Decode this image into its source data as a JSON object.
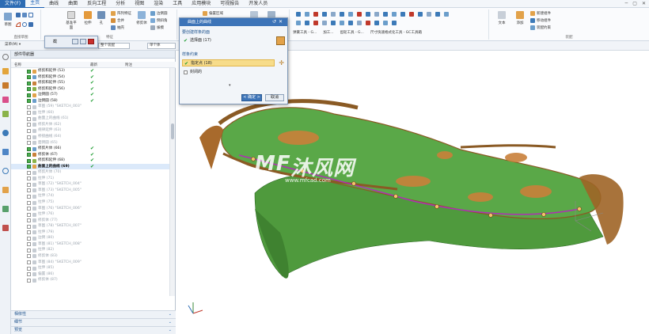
{
  "menubar": {
    "file_label": "文件(F)",
    "items": [
      "主页",
      "曲线",
      "曲面",
      "反向工程",
      "分析",
      "视图",
      "渲染",
      "工具",
      "应用模块",
      "可视报告",
      "开发人员"
    ],
    "window_controls": [
      "─",
      "▢",
      "✕"
    ]
  },
  "ribbon": {
    "groups": [
      {
        "label": "直接草图"
      },
      {
        "label": "特征"
      },
      {
        "label": "同步建模"
      },
      {
        "label": "尺寸快速格式化工具 - GC工具箱"
      },
      {
        "label": "装配"
      }
    ],
    "buttons": {
      "sketch": "草图",
      "datum_plane": "基准平面",
      "extrude": "拉伸",
      "hole": "孔",
      "pattern_feature": "阵列特征",
      "unite": "合并",
      "shell": "抽壳",
      "trim_body": "修剪体",
      "offset_region": "偏置区域",
      "replace_face": "替换面",
      "move_face": "移动面",
      "draft": "拔模",
      "more": "更多",
      "add_component": "添加",
      "new_component": "新建组件",
      "move_component": "移动组件",
      "assembly_constraint": "装配约束",
      "edge_blend": "边倒圆",
      "chamfer": "倒斜角",
      "text": "文本"
    },
    "toolbar_labels": [
      "弹簧工具 - G...",
      "加工...",
      "齿轮工具 - G...",
      "尺寸快速格式化工具 - GC工具箱"
    ]
  },
  "toolbar2": {
    "menu_label": "菜单(M) ▾",
    "filter_value": "没有选择过滤器",
    "assembly_value": "整个装配",
    "selection_value": "单个体"
  },
  "miniwin": {
    "title": "截"
  },
  "navigator": {
    "title": "部件导航器",
    "columns": {
      "name": "名称",
      "latest": "最新",
      "comment": "附注"
    },
    "rows": [
      {
        "label": "修剪和延伸 (53)",
        "state": "on"
      },
      {
        "label": "修剪和延伸 (54)",
        "state": "on"
      },
      {
        "label": "修剪和延伸 (55)",
        "state": "on"
      },
      {
        "label": "修剪和延伸 (56)",
        "state": "on"
      },
      {
        "label": "边倒圆 (57)",
        "state": "on"
      },
      {
        "label": "边倒圆 (58)",
        "state": "on"
      },
      {
        "label": "草图 (59) \"SKETCH_003\"",
        "state": "off"
      },
      {
        "label": "拉伸 (60)",
        "state": "off"
      },
      {
        "label": "曲面上的曲线 (61)",
        "state": "off"
      },
      {
        "label": "修剪片体 (62)",
        "state": "off"
      },
      {
        "label": "规律延伸 (63)",
        "state": "off"
      },
      {
        "label": "桥接曲线 (64)",
        "state": "off"
      },
      {
        "label": "面倒圆 (65)",
        "state": "off"
      },
      {
        "label": "修剪片体 (66)",
        "state": "on"
      },
      {
        "label": "修剪体 (67)",
        "state": "on"
      },
      {
        "label": "修剪和延伸 (68)",
        "state": "on"
      },
      {
        "label": "曲面上的曲线 (69)",
        "state": "bold"
      },
      {
        "label": "修剪片体 (70)",
        "state": "off"
      },
      {
        "label": "拉伸 (71)",
        "state": "off"
      },
      {
        "label": "草图 (72) \"SKETCH_004\"",
        "state": "off"
      },
      {
        "label": "草图 (73) \"SKETCH_005\"",
        "state": "off"
      },
      {
        "label": "拉伸 (74)",
        "state": "off"
      },
      {
        "label": "拉伸 (75)",
        "state": "off"
      },
      {
        "label": "草图 (76) \"SKETCH_006\"",
        "state": "off"
      },
      {
        "label": "拉伸 (76)",
        "state": "off"
      },
      {
        "label": "修剪体 (77)",
        "state": "off"
      },
      {
        "label": "草图 (78) \"SKETCH_007\"",
        "state": "off"
      },
      {
        "label": "拉伸 (79)",
        "state": "off"
      },
      {
        "label": "边倒 (80)",
        "state": "off"
      },
      {
        "label": "草图 (81) \"SKETCH_008\"",
        "state": "off"
      },
      {
        "label": "拉伸 (82)",
        "state": "off"
      },
      {
        "label": "修剪体 (83)",
        "state": "off"
      },
      {
        "label": "草图 (84) \"SKETCH_009\"",
        "state": "off"
      },
      {
        "label": "拉伸 (85)",
        "state": "off"
      },
      {
        "label": "偏置 (86)",
        "state": "off"
      },
      {
        "label": "修剪体 (87)",
        "state": "off"
      }
    ],
    "latest_mark": "✔"
  },
  "accordion": [
    {
      "label": "相依性"
    },
    {
      "label": "细节"
    },
    {
      "label": "预览"
    }
  ],
  "dialog": {
    "title": "曲面上的曲线",
    "section1": "要创建样条的面",
    "item1": "选择面 (17)",
    "section2": "样条约束",
    "item2": "指定点 (18)",
    "item3": "封闭的",
    "ok_label": "< 确定 >",
    "cancel_label": "取消"
  },
  "watermark": {
    "main": "沐风网",
    "sub": "www.mfcad.com",
    "logo": "MF"
  },
  "colors": {
    "accent": "#2d6cb4",
    "surface_green": "#4c9d3c",
    "surface_orange": "#c9803a",
    "curve_magenta": "#b02fb5",
    "dialog_highlight": "#f7dc8a"
  }
}
